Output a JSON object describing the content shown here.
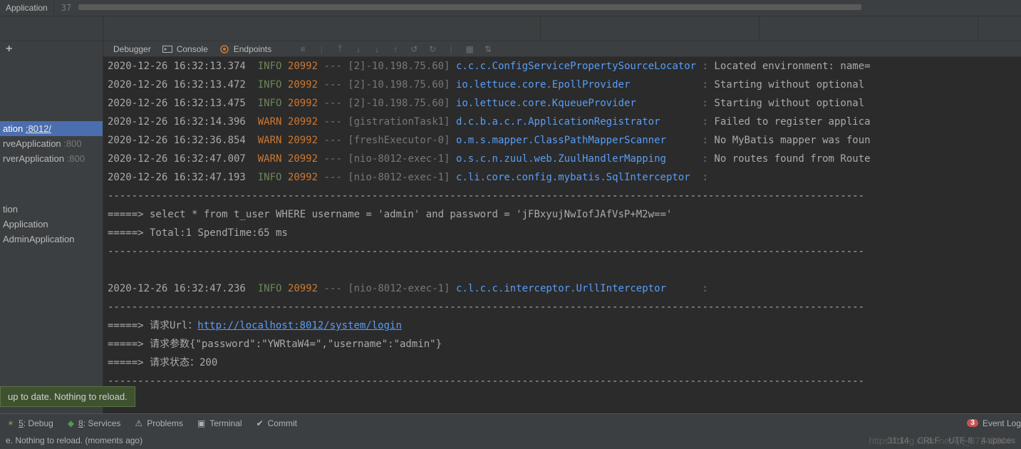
{
  "topbar": {
    "app_label": "Application",
    "number": "37"
  },
  "sidebar": {
    "items": [
      {
        "name": "ation",
        "port": ":8012/",
        "selected": true
      },
      {
        "name": "rveApplication",
        "port": ":800",
        "selected": false
      },
      {
        "name": "rverApplication",
        "port": ":800",
        "selected": false
      }
    ],
    "extra": [
      {
        "name": "tion"
      },
      {
        "name": "Application"
      },
      {
        "name": "AdminApplication"
      }
    ]
  },
  "tabs": {
    "debugger": "Debugger",
    "console": "Console",
    "endpoints": "Endpoints"
  },
  "log": {
    "lines": [
      {
        "time": "2020-12-26 16:32:13.374",
        "level": "INFO",
        "pid": "20992",
        "thread": "[2]-10.198.75.60]",
        "logger": "c.c.c.ConfigServicePropertySourceLocator",
        "msg": "Located environment: name="
      },
      {
        "time": "2020-12-26 16:32:13.472",
        "level": "INFO",
        "pid": "20992",
        "thread": "[2]-10.198.75.60]",
        "logger": "io.lettuce.core.EpollProvider",
        "msg": "Starting without optional"
      },
      {
        "time": "2020-12-26 16:32:13.475",
        "level": "INFO",
        "pid": "20992",
        "thread": "[2]-10.198.75.60]",
        "logger": "io.lettuce.core.KqueueProvider",
        "msg": "Starting without optional"
      },
      {
        "time": "2020-12-26 16:32:14.396",
        "level": "WARN",
        "pid": "20992",
        "thread": "[gistrationTask1]",
        "logger": "d.c.b.a.c.r.ApplicationRegistrator",
        "msg": "Failed to register applica"
      },
      {
        "time": "2020-12-26 16:32:36.854",
        "level": "WARN",
        "pid": "20992",
        "thread": "[freshExecutor-0]",
        "logger": "o.m.s.mapper.ClassPathMapperScanner",
        "msg": "No MyBatis mapper was foun"
      },
      {
        "time": "2020-12-26 16:32:47.007",
        "level": "WARN",
        "pid": "20992",
        "thread": "[nio-8012-exec-1]",
        "logger": "o.s.c.n.zuul.web.ZuulHandlerMapping",
        "msg": "No routes found from Route"
      },
      {
        "time": "2020-12-26 16:32:47.193",
        "level": "INFO",
        "pid": "20992",
        "thread": "[nio-8012-exec-1]",
        "logger": "c.li.core.config.mybatis.SqlInterceptor",
        "msg": ""
      }
    ],
    "dash1": "------------------------------------------------------------------------------------------------------------------------------",
    "sql_line": "=====> select * from t_user WHERE username = 'admin' and password = 'jFBxyujNwIofJAfVsP+M2w=='",
    "total_line": "=====> Total:1 SpendTime:65 ms",
    "dash2": "------------------------------------------------------------------------------------------------------------------------------",
    "line8": {
      "time": "2020-12-26 16:32:47.236",
      "level": "INFO",
      "pid": "20992",
      "thread": "[nio-8012-exec-1]",
      "logger": "c.l.c.c.interceptor.UrllInterceptor",
      "msg": ""
    },
    "dash3": "------------------------------------------------------------------------------------------------------------------------------",
    "url_prefix": "=====> 请求Url：",
    "url_link": "http://localhost:8012/system/login",
    "param_line": "=====> 请求参数{\"password\":\"YWRtaW4=\",\"username\":\"admin\"}",
    "status_line": "=====> 请求状态：200",
    "dash4": "------------------------------------------------------------------------------------------------------------------------------"
  },
  "tooltip": "up to date. Nothing to reload.",
  "bottom": {
    "debug": "5: Debug",
    "services": "8: Services",
    "problems": "Problems",
    "terminal": "Terminal",
    "commit": "Commit",
    "eventlog": "Event Log",
    "badge": "3"
  },
  "status": {
    "msg": "e. Nothing to reload. (moments ago)",
    "pos": "31:14",
    "sep": "CRLF",
    "enc": "UTF-8",
    "indent": "4 spaces"
  },
  "watermark": "https://blog.csdn.net/qq_37248504"
}
